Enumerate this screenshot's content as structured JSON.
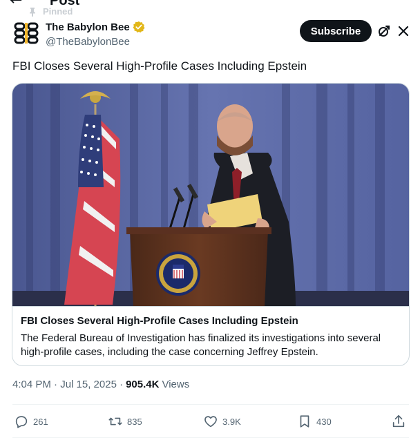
{
  "header": {
    "title": "Post",
    "pinned_label": "Pinned"
  },
  "author": {
    "display_name": "The Babylon Bee",
    "handle": "@TheBabylonBee",
    "verified_color": "#e2b719"
  },
  "buttons": {
    "subscribe_label": "Subscribe"
  },
  "post": {
    "text": "FBI Closes Several High-Profile Cases Including Epstein"
  },
  "card": {
    "title": "FBI Closes Several High-Profile Cases Including Epstein",
    "description": "The Federal Bureau of Investigation has finalized its investigations into several high-profile cases, including the case concerning Jeffrey Epstein.",
    "image_icon": "press-conference-photo"
  },
  "meta": {
    "time": "4:04 PM · Jul 15, 2025 ·",
    "views_count": "905.4K",
    "views_label": "Views"
  },
  "actions": {
    "replies": "261",
    "reposts": "835",
    "likes": "3.9K",
    "bookmarks": "430"
  },
  "colors": {
    "accent_dark": "#0f1419",
    "muted": "#536471",
    "border": "#cfd9de"
  }
}
